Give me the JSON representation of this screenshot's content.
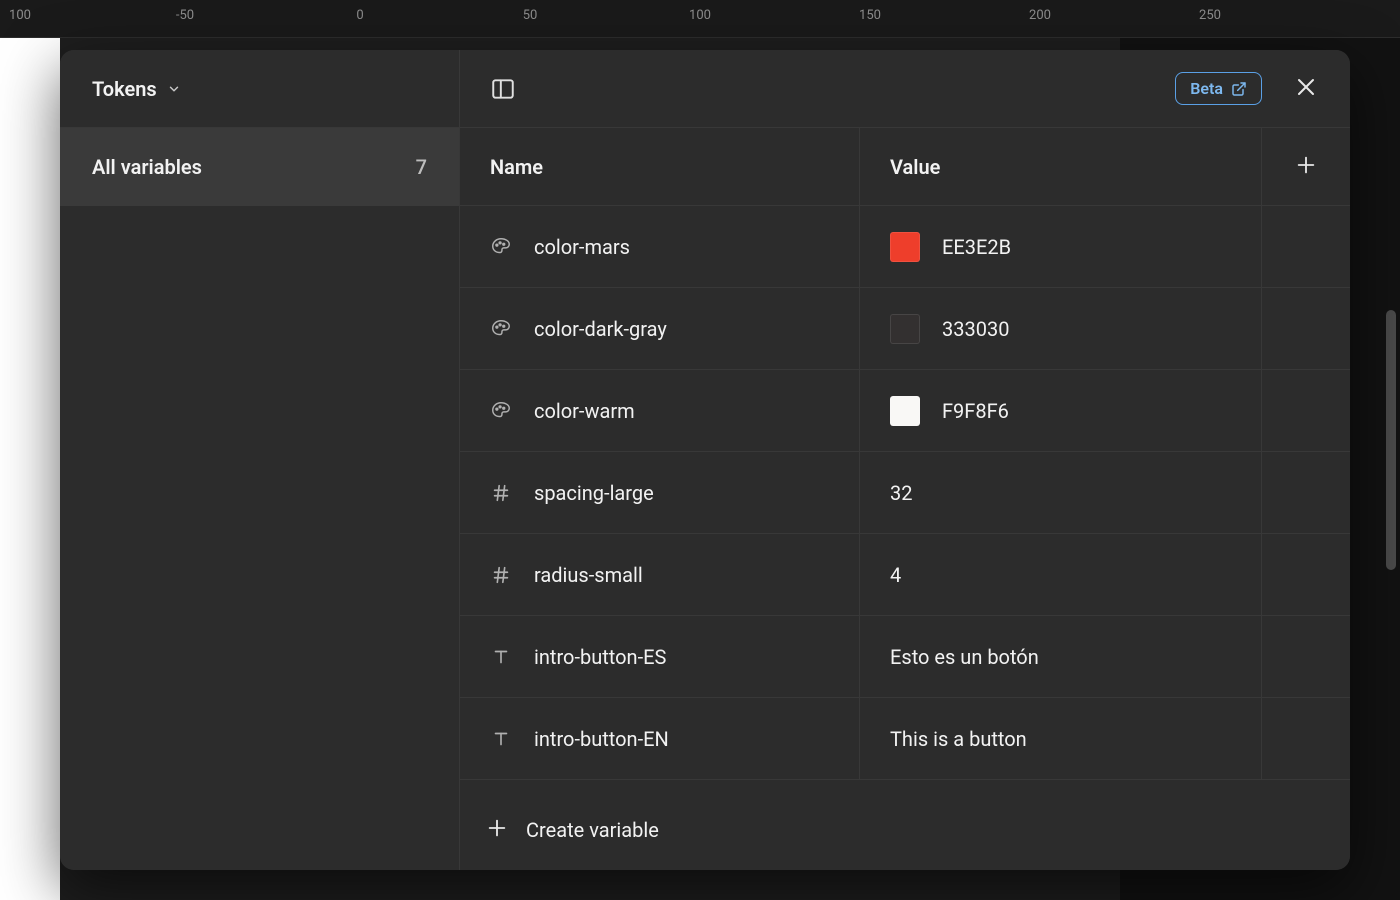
{
  "ruler": {
    "ticks": [
      "100",
      "-50",
      "0",
      "50",
      "100",
      "150",
      "200",
      "250"
    ]
  },
  "sidebar": {
    "title": "Tokens",
    "item_label": "All variables",
    "item_count": "7"
  },
  "toolbar": {
    "beta_label": "Beta"
  },
  "table": {
    "header_name": "Name",
    "header_value": "Value"
  },
  "variables": [
    {
      "type": "color",
      "name": "color-mars",
      "value": "EE3E2B",
      "swatch": "#EE3E2B"
    },
    {
      "type": "color",
      "name": "color-dark-gray",
      "value": "333030",
      "swatch": "#333030"
    },
    {
      "type": "color",
      "name": "color-warm",
      "value": "F9F8F6",
      "swatch": "#F9F8F6"
    },
    {
      "type": "number",
      "name": "spacing-large",
      "value": "32"
    },
    {
      "type": "number",
      "name": "radius-small",
      "value": "4"
    },
    {
      "type": "string",
      "name": "intro-button-ES",
      "value": "Esto es un botón"
    },
    {
      "type": "string",
      "name": "intro-button-EN",
      "value": "This is a button"
    }
  ],
  "footer": {
    "create_label": "Create variable"
  }
}
